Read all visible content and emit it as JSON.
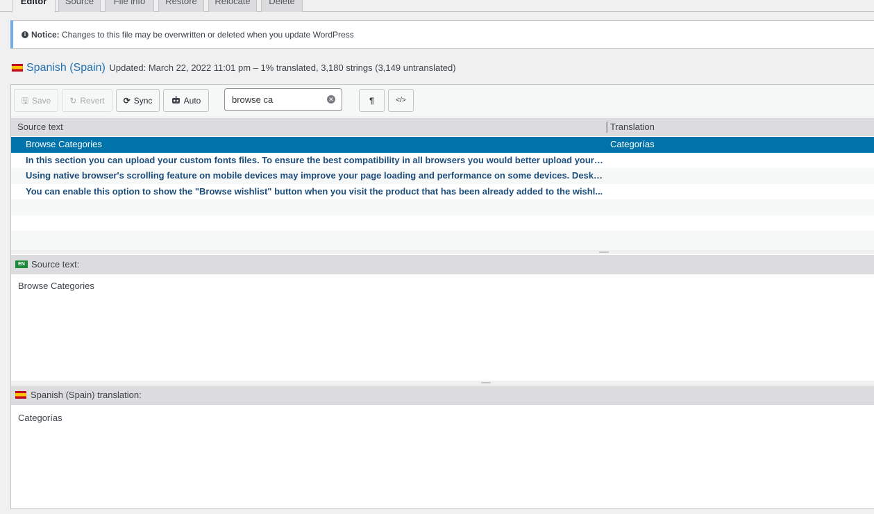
{
  "tabs": [
    {
      "label": "Editor",
      "active": true
    },
    {
      "label": "Source",
      "active": false
    },
    {
      "label": "File info",
      "active": false
    },
    {
      "label": "Restore",
      "active": false
    },
    {
      "label": "Relocate",
      "active": false
    },
    {
      "label": "Delete",
      "active": false
    }
  ],
  "notice": {
    "label": "Notice:",
    "text": "Changes to this file may be overwritten or deleted when you update WordPress"
  },
  "language": {
    "name": "Spanish (Spain)",
    "status": "Updated: March 22, 2022 11:01 pm – 1% translated, 3,180 strings (3,149 untranslated)"
  },
  "toolbar": {
    "save": "Save",
    "revert": "Revert",
    "sync": "Sync",
    "auto": "Auto",
    "search_value": "browse ca",
    "pilcrow": "¶",
    "code": "</>"
  },
  "table": {
    "columns": [
      "Source text",
      "Translation"
    ],
    "rows": [
      {
        "source": "Browse Categories",
        "translation": "Categorías",
        "selected": true
      },
      {
        "source": "In this section you can upload your custom fonts files. To ensure the best compatibility in all browsers you would better upload your ...",
        "translation": ""
      },
      {
        "source": "Using native browser's scrolling feature on mobile devices may improve your page loading and performance on some devices. Deskt...",
        "translation": ""
      },
      {
        "source": "You can enable this option to show the \"Browse wishlist\" button when you visit the product that has been already added to the wishl...",
        "translation": ""
      }
    ]
  },
  "source_panel": {
    "badge": "EN",
    "label": "Source text:",
    "text": "Browse Categories"
  },
  "translation_panel": {
    "label": "Spanish (Spain) translation:",
    "text": "Categorías"
  },
  "colors": {
    "selected_row": "#0073aa",
    "link": "#2271b1",
    "notice_border": "#72aee6"
  }
}
